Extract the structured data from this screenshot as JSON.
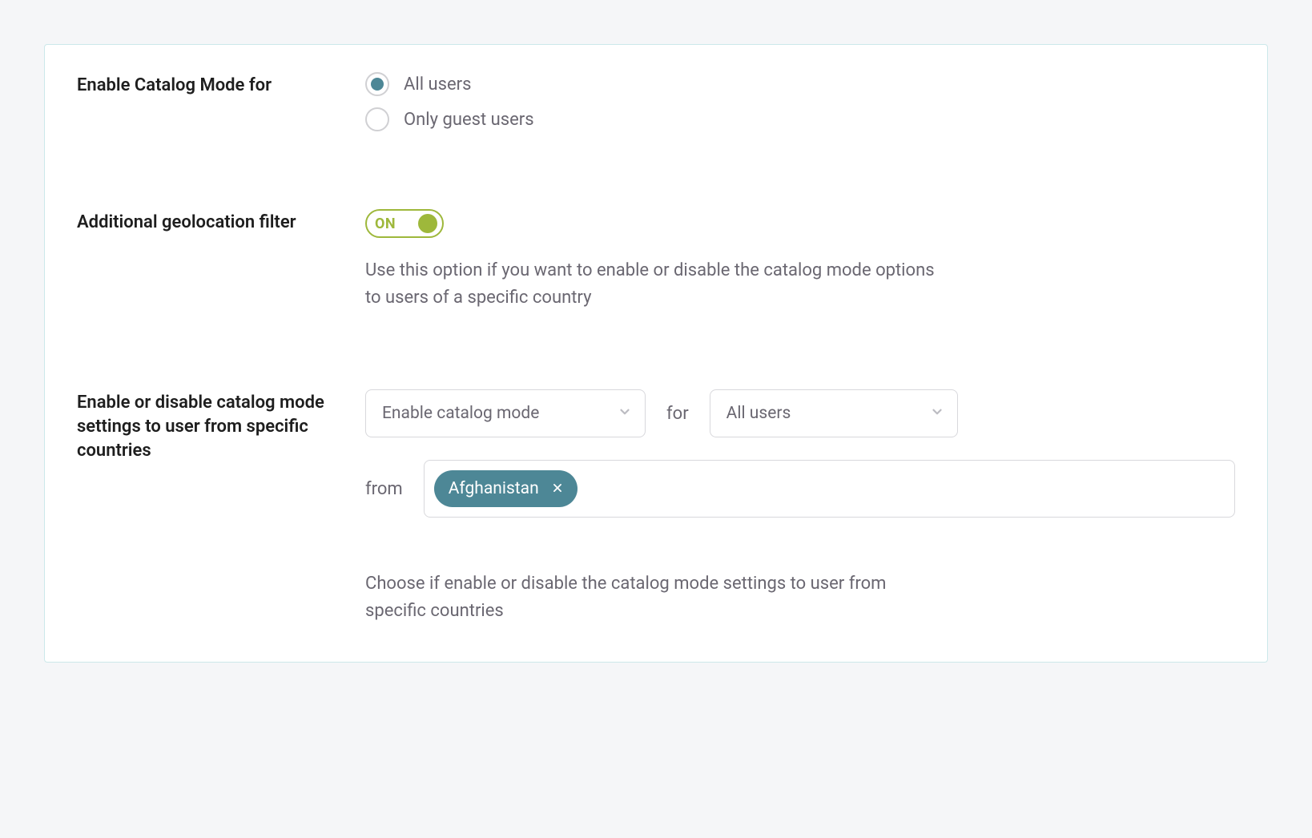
{
  "enableFor": {
    "label": "Enable Catalog Mode for",
    "options": {
      "all": "All users",
      "guest": "Only guest users"
    },
    "selected": "all"
  },
  "geoFilter": {
    "label": "Additional geolocation filter",
    "toggle": {
      "on": true,
      "text": "ON"
    },
    "description": "Use this option if you want to enable or disable the catalog mode options to users of a specific country"
  },
  "geoRule": {
    "label": "Enable or disable catalog mode settings to user from specific countries",
    "action": {
      "value": "Enable catalog mode"
    },
    "forText": "for",
    "audience": {
      "value": "All users"
    },
    "fromText": "from",
    "countries": [
      {
        "name": "Afghanistan"
      }
    ],
    "help": "Choose if enable or disable the catalog mode settings to user from specific countries"
  }
}
